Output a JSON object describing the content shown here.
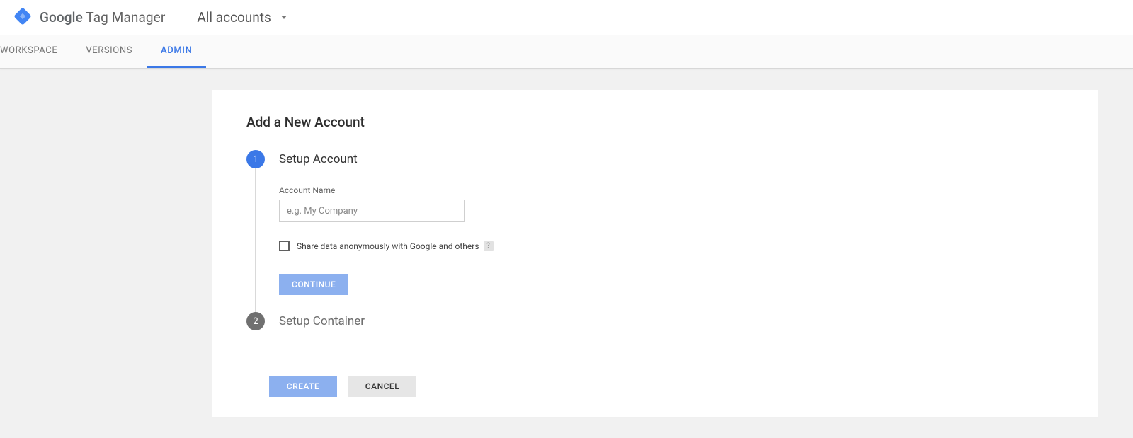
{
  "header": {
    "logo_bold": "Google",
    "logo_rest": " Tag Manager",
    "account_picker": "All accounts"
  },
  "tabs": {
    "workspace": "WORKSPACE",
    "versions": "VERSIONS",
    "admin": "ADMIN"
  },
  "form": {
    "title": "Add a New Account",
    "step1": {
      "number": "1",
      "title": "Setup Account",
      "account_label": "Account Name",
      "account_placeholder": "e.g. My Company",
      "share_label": "Share data anonymously with Google and others",
      "help": "?",
      "continue": "CONTINUE"
    },
    "step2": {
      "number": "2",
      "title": "Setup Container"
    },
    "actions": {
      "create": "CREATE",
      "cancel": "CANCEL"
    }
  }
}
